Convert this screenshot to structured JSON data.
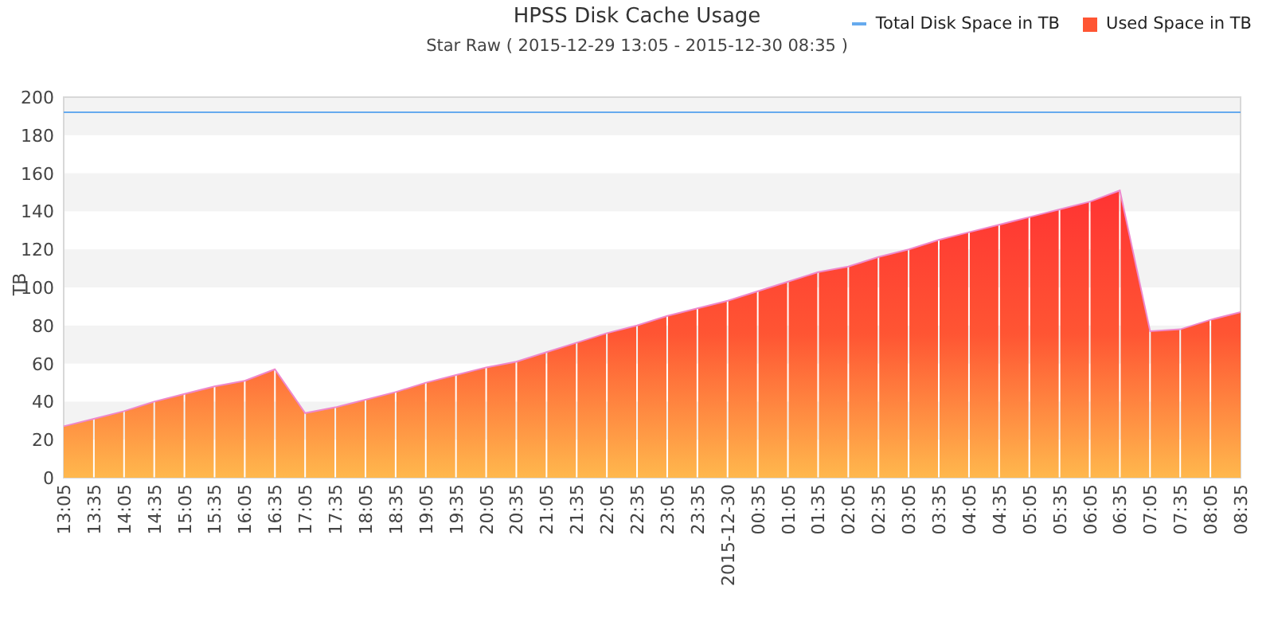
{
  "chart_data": {
    "type": "area",
    "title": "HPSS Disk Cache Usage",
    "subtitle": "Star Raw ( 2015-12-29 13:05 - 2015-12-30 08:35 )",
    "ylabel": "TB",
    "bands": [
      {
        "axis": "y",
        "from": 20,
        "to": 40,
        "color": "#f3f3f3"
      },
      {
        "axis": "y",
        "from": 60,
        "to": 80,
        "color": "#f3f3f3"
      },
      {
        "axis": "y",
        "from": 100,
        "to": 120,
        "color": "#f3f3f3"
      },
      {
        "axis": "y",
        "from": 140,
        "to": 160,
        "color": "#f3f3f3"
      },
      {
        "axis": "y",
        "from": 180,
        "to": 200,
        "color": "#f3f3f3"
      }
    ],
    "categories": [
      "13:05",
      "13:35",
      "14:05",
      "14:35",
      "15:05",
      "15:35",
      "16:05",
      "16:35",
      "17:05",
      "17:35",
      "18:05",
      "18:35",
      "19:05",
      "19:35",
      "20:05",
      "20:35",
      "21:05",
      "21:35",
      "22:05",
      "22:35",
      "23:05",
      "23:35",
      "2015-12-30",
      "00:35",
      "01:05",
      "01:35",
      "02:05",
      "02:35",
      "03:05",
      "03:35",
      "04:05",
      "04:35",
      "05:05",
      "05:35",
      "06:05",
      "06:35",
      "07:05",
      "07:35",
      "08:05",
      "08:35"
    ],
    "ylim": [
      0,
      200
    ],
    "yticks": [
      0,
      20,
      40,
      60,
      80,
      100,
      120,
      140,
      160,
      180,
      200
    ],
    "ref_lines": [
      {
        "axis": "y",
        "value": 192,
        "label": "Total Disk Space in TB",
        "color": "#66aaee"
      }
    ],
    "series": [
      {
        "name": "Used Space in TB",
        "color": "#ff5533",
        "values": [
          27,
          31,
          35,
          40,
          44,
          48,
          51,
          57,
          34,
          37,
          41,
          45,
          50,
          54,
          58,
          61,
          66,
          71,
          76,
          80,
          85,
          89,
          93,
          98,
          103,
          108,
          111,
          116,
          120,
          125,
          129,
          133,
          137,
          141,
          145,
          151,
          77,
          78,
          83,
          87
        ]
      }
    ]
  }
}
